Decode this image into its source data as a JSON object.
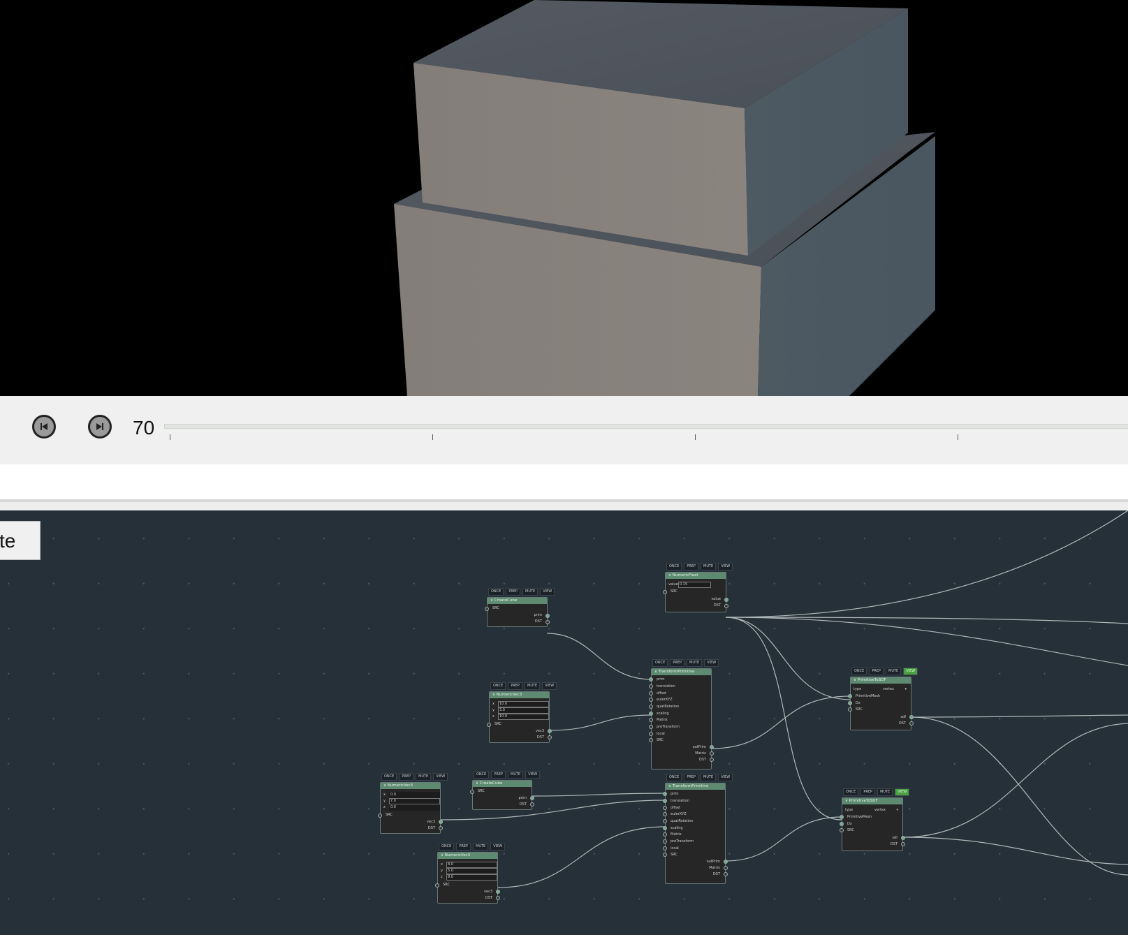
{
  "timeline": {
    "prev_icon": "skip-back-icon",
    "next_icon": "skip-forward-icon",
    "frame": "70"
  },
  "graph": {
    "button_label": "te",
    "flags": [
      "ONCE",
      "PREP",
      "MUTE",
      "VIEW"
    ],
    "nodes": {
      "numeric_float": {
        "title": "NumericFloat",
        "value_label": "value",
        "value": "0.15",
        "src": "SRC",
        "out_value": "value",
        "out_dst": "DST"
      },
      "create_cube_1": {
        "title": "CreateCube",
        "src": "SRC",
        "out_prim": "prim",
        "out_dst": "DST"
      },
      "numeric_vec3_1": {
        "title": "NumericVec3",
        "x_label": "x",
        "x": "10.0",
        "y_label": "y",
        "y": "3.0",
        "z_label": "z",
        "z": "10.0",
        "src": "SRC",
        "out_vec3": "vec3",
        "out_dst": "DST"
      },
      "transform_1": {
        "title": "TransformPrimitive",
        "inputs": [
          "prim",
          "translation",
          "offset",
          "eulerXYZ",
          "quatRotation",
          "scaling",
          "Matrix",
          "preTransform",
          "local",
          "SRC"
        ],
        "outputs": [
          "outPrim",
          "Matrix",
          "DST"
        ]
      },
      "prim_to_sdf_1": {
        "title": "PrimitiveToSDF",
        "type_label": "type",
        "type_value": "vertex",
        "inputs": [
          "PrimitiveMesh",
          "Dx",
          "SRC"
        ],
        "outputs": [
          "sdf",
          "DST"
        ]
      },
      "numeric_vec3_2": {
        "title": "NumericVec3",
        "x_label": "x",
        "x": "0.0",
        "y_label": "y",
        "y": "7.0",
        "z_label": "z",
        "z": "0.0",
        "src": "SRC",
        "out_vec3": "vec3",
        "out_dst": "DST"
      },
      "create_cube_2": {
        "title": "CreateCube",
        "src": "SRC",
        "out_prim": "prim",
        "out_dst": "DST"
      },
      "transform_2": {
        "title": "TransformPrimitive",
        "inputs": [
          "prim",
          "translation",
          "offset",
          "eulerXYZ",
          "quatRotation",
          "scaling",
          "Matrix",
          "preTransform",
          "local",
          "SRC"
        ],
        "outputs": [
          "outPrim",
          "Matrix",
          "DST"
        ]
      },
      "numeric_vec3_3": {
        "title": "NumericVec3",
        "x_label": "x",
        "x": "8.0",
        "y_label": "y",
        "y": "5.0",
        "z_label": "z",
        "z": "8.0",
        "src": "SRC",
        "out_vec3": "vec3",
        "out_dst": "DST"
      },
      "prim_to_sdf_2": {
        "title": "PrimitiveToSDF",
        "type_label": "type",
        "type_value": "vertex",
        "inputs": [
          "PrimitiveMesh",
          "Dx",
          "SRC"
        ],
        "outputs": [
          "sdf",
          "DST"
        ]
      }
    }
  },
  "colors": {
    "graph_bg": "#263038",
    "node_header": "#5d8a70",
    "view_flag_active": "#4aa043",
    "wire": "#c8d0d0"
  }
}
